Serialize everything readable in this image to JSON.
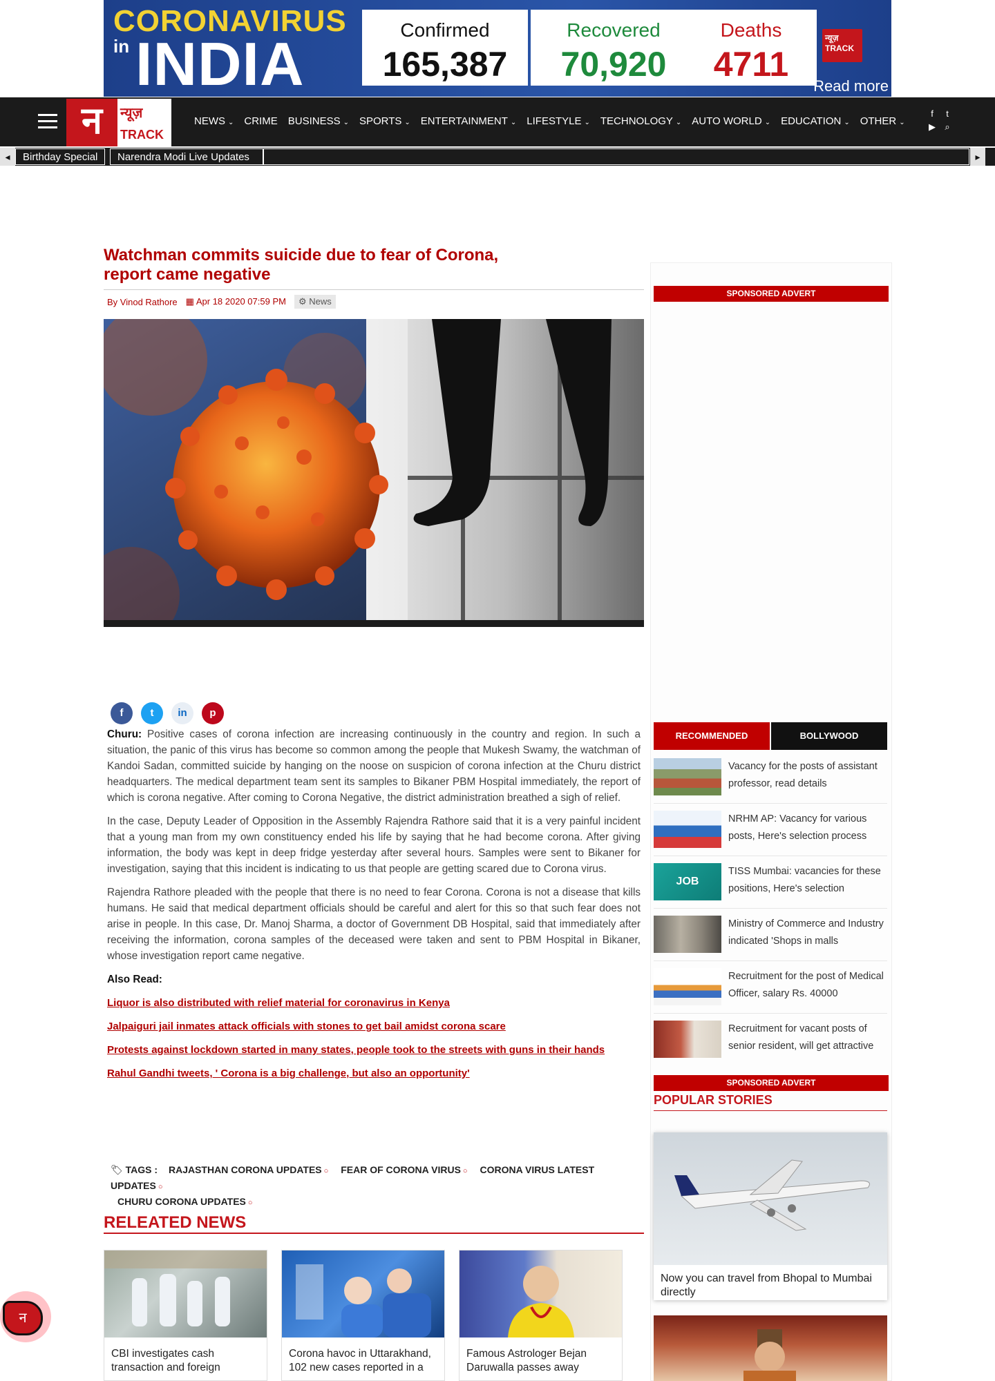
{
  "banner": {
    "line1": "CORONAVIRUS",
    "line2": "in",
    "line3": "INDIA",
    "confirmed_label": "Confirmed",
    "confirmed_value": "165,387",
    "recovered_label": "Recovered",
    "recovered_value": "70,920",
    "deaths_label": "Deaths",
    "deaths_value": "4711",
    "logo_text": "न्यूज़ TRACK",
    "read_more": "Read more",
    "colors": {
      "confirmed": "#111111",
      "recovered": "#1e8a3c",
      "deaths": "#c4161c"
    }
  },
  "nav": {
    "logo_mark": "न",
    "logo_top": "न्यूज़",
    "logo_bottom": "TRACK",
    "items": [
      {
        "label": "NEWS",
        "chev": "⌄"
      },
      {
        "label": "CRIME",
        "chev": ""
      },
      {
        "label": "BUSINESS",
        "chev": "⌄"
      },
      {
        "label": "SPORTS",
        "chev": "⌄"
      },
      {
        "label": "ENTERTAINMENT",
        "chev": "⌄"
      },
      {
        "label": "LIFESTYLE",
        "chev": "⌄"
      },
      {
        "label": "TECHNOLOGY",
        "chev": "⌄"
      },
      {
        "label": "AUTO WORLD",
        "chev": "⌄"
      },
      {
        "label": "EDUCATION",
        "chev": "⌄"
      },
      {
        "label": "OTHER",
        "chev": "⌄"
      }
    ],
    "social": [
      "f",
      "t",
      "▶",
      "⌕"
    ]
  },
  "ticker": {
    "items": [
      "Birthday Special",
      "Narendra Modi Live Updates"
    ],
    "left": "◂",
    "right": "▸"
  },
  "article": {
    "title": "Watchman commits suicide due to fear of Corona, report came negative",
    "author": "By Vinod Rathore",
    "date": "Apr 18 2020 07:59 PM",
    "category": "News",
    "share": [
      "f",
      "t",
      "in",
      "p"
    ],
    "dateline": "Churu:",
    "p1": "Positive cases of corona infection are increasing continuously in the country and region. In such a situation, the panic of this virus has become so common among the people that Mukesh Swamy, the watchman of Kandoi Sadan, committed suicide by hanging on the noose on suspicion of corona infection at the Churu district headquarters. The medical department team sent its samples to Bikaner PBM Hospital immediately, the report of which is corona negative. After coming to Corona Negative, the district administration breathed a sigh of relief.",
    "p2": "In the case, Deputy Leader of Opposition in the Assembly Rajendra Rathore said that it is a very painful incident that a young man from my own constituency ended his life by saying that he had become corona. After giving information, the body was kept in deep fridge yesterday after several hours. Samples were sent to Bikaner for investigation, saying that this incident is indicating to us that people are getting scared due to Corona virus.",
    "p3": "Rajendra Rathore pleaded with the people that there is no need to fear Corona. Corona is not a disease that kills humans. He said that medical department officials should be careful and alert for this so that such fear does not arise in people. In this case, Dr. Manoj Sharma, a doctor of Government DB Hospital, said that immediately after receiving the information, corona samples of the deceased were taken and sent to PBM Hospital in Bikaner, whose investigation report came negative.",
    "also_read": "Also Read:",
    "links": [
      "Liquor is also distributed with relief material for coronavirus in Kenya",
      "Jalpaiguri jail inmates attack officials with stones to get bail amidst corona scare",
      "Protests against lockdown started in many states, people took to the streets with guns in their hands",
      "Rahul Gandhi tweets, ' Corona is a big challenge, but also an opportunity'"
    ],
    "tags_label": "TAGS :",
    "tags": [
      "RAJASTHAN CORONA UPDATES",
      "FEAR OF CORONA VIRUS",
      "CORONA VIRUS LATEST UPDATES",
      "CHURU CORONA UPDATES"
    ]
  },
  "related": {
    "heading": "RELEATED NEWS",
    "items": [
      "CBI investigates cash transaction and foreign",
      "Corona havoc in Uttarakhand, 102 new cases reported in a",
      "Famous Astrologer Bejan Daruwalla passes away"
    ]
  },
  "sidebar": {
    "sponsored": "SPONSORED ADVERT",
    "tab_recommended": "RECOMMENDED",
    "tab_bollywood": "BOLLYWOOD",
    "recommended": [
      "Vacancy for the posts of assistant professor, read details",
      "NRHM AP: Vacancy for various posts, Here's selection process",
      "TISS Mumbai: vacancies for these positions, Here's selection",
      "Ministry of Commerce and Industry indicated 'Shops in malls",
      "Recruitment for the post of Medical Officer, salary Rs. 40000",
      "Recruitment for vacant posts of senior resident, will get attractive"
    ],
    "popular_heading": "POPULAR STORIES",
    "popular": [
      "Now you can travel from Bhopal to Mumbai directly"
    ]
  },
  "fab_mark": "न"
}
